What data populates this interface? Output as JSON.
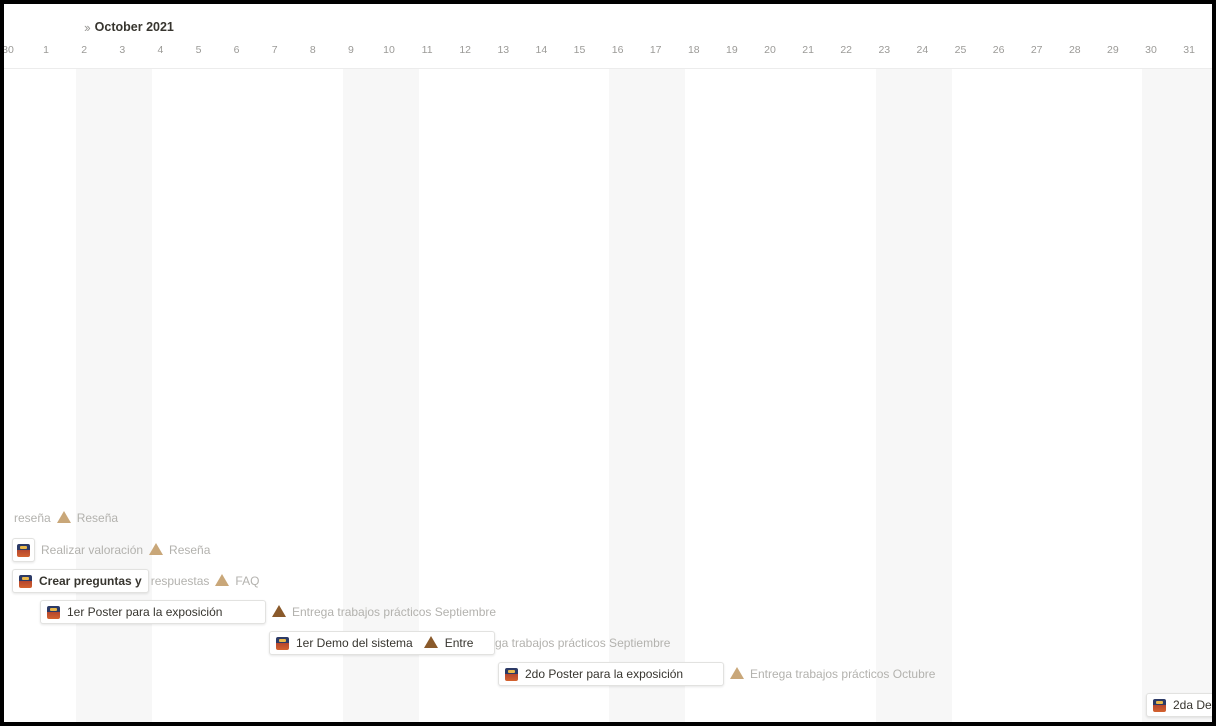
{
  "month_label": "October 2021",
  "nav_icon": "double-chevron-right-icon",
  "days": [
    "30",
    "1",
    "2",
    "3",
    "4",
    "5",
    "6",
    "7",
    "8",
    "9",
    "10",
    "11",
    "12",
    "13",
    "14",
    "15",
    "16",
    "17",
    "18",
    "19",
    "20",
    "21",
    "22",
    "23",
    "24",
    "25",
    "26",
    "27",
    "28",
    "29",
    "30",
    "31"
  ],
  "rows": {
    "r1": {
      "task_label": "reseña",
      "relation_label": "Reseña"
    },
    "r2": {
      "task_label": "Realizar valoración",
      "relation_label": "Reseña"
    },
    "r3": {
      "task_label": "Crear preguntas y",
      "task_label_overflow": "respuestas",
      "relation_label": "FAQ"
    },
    "r4": {
      "task_label": "1er Poster para la exposición",
      "relation_label": "Entrega trabajos prácticos Septiembre"
    },
    "r5": {
      "task_label": "1er Demo del sistema",
      "relation_label_visible": "Entre",
      "relation_label_overflow": "ga trabajos prácticos Septiembre"
    },
    "r6": {
      "task_label": "2do Poster para la exposición",
      "relation_label": "Entrega trabajos prácticos Octubre"
    },
    "r7": {
      "task_label": "2da De"
    }
  },
  "colors": {
    "weekend_band": "#f7f7f7",
    "faded_text": "#b3b2ae",
    "text": "#37352f",
    "frame": "#000000"
  }
}
